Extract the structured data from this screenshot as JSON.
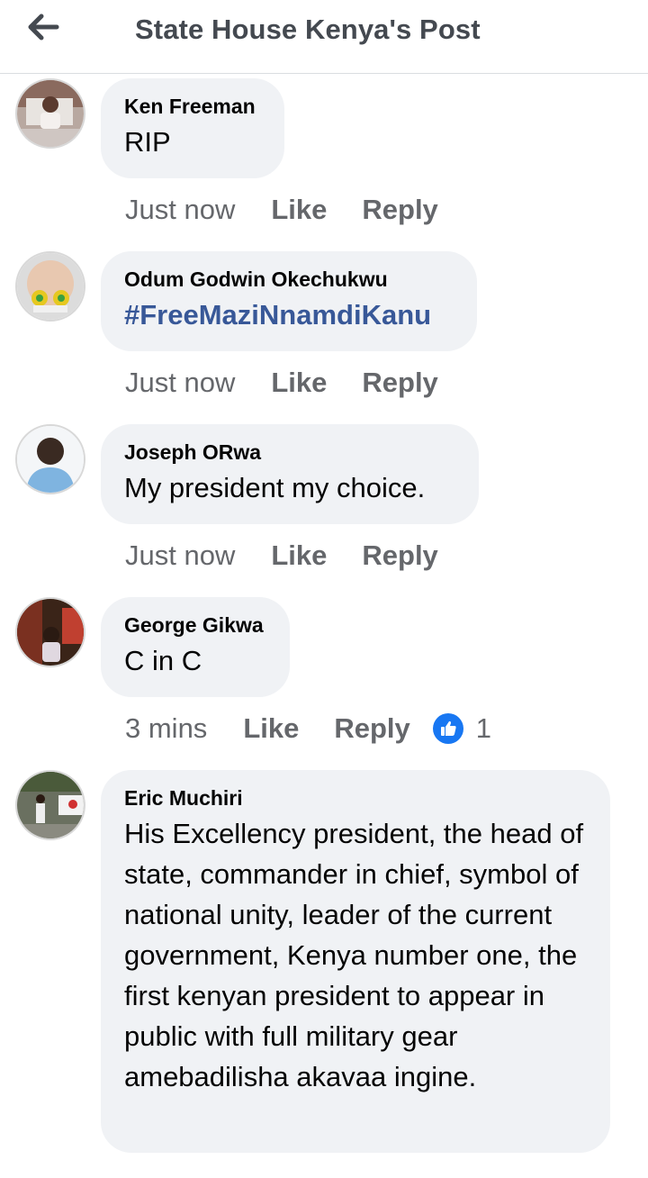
{
  "header": {
    "title": "State House Kenya's Post",
    "back_icon": "arrow-left-icon"
  },
  "colors": {
    "bubble_bg": "#f0f2f5",
    "hashtag": "#385898",
    "action_text": "#65676b",
    "like_blue": "#1877f2"
  },
  "comments": [
    {
      "author": "Ken Freeman",
      "text": "RIP",
      "time": "Just now",
      "like_label": "Like",
      "reply_label": "Reply"
    },
    {
      "author": "Odum Godwin Okechukwu",
      "text": "#FreeMaziNnamdiKanu",
      "time": "Just now",
      "like_label": "Like",
      "reply_label": "Reply"
    },
    {
      "author": "Joseph ORwa",
      "text": "My president my choice.",
      "time": "Just now",
      "like_label": "Like",
      "reply_label": "Reply"
    },
    {
      "author": "George Gikwa",
      "text": "C in C",
      "time": "3 mins",
      "like_label": "Like",
      "reply_label": "Reply",
      "reaction_icon": "thumbs-up-icon",
      "reaction_count": "1"
    },
    {
      "author": "Eric Muchiri",
      "text": "His Excellency president, the head of state, commander in chief, symbol of national unity, leader of the current government, Kenya number one, the first kenyan president to appear in public with full military gear amebadilisha akavaa ingine."
    }
  ]
}
